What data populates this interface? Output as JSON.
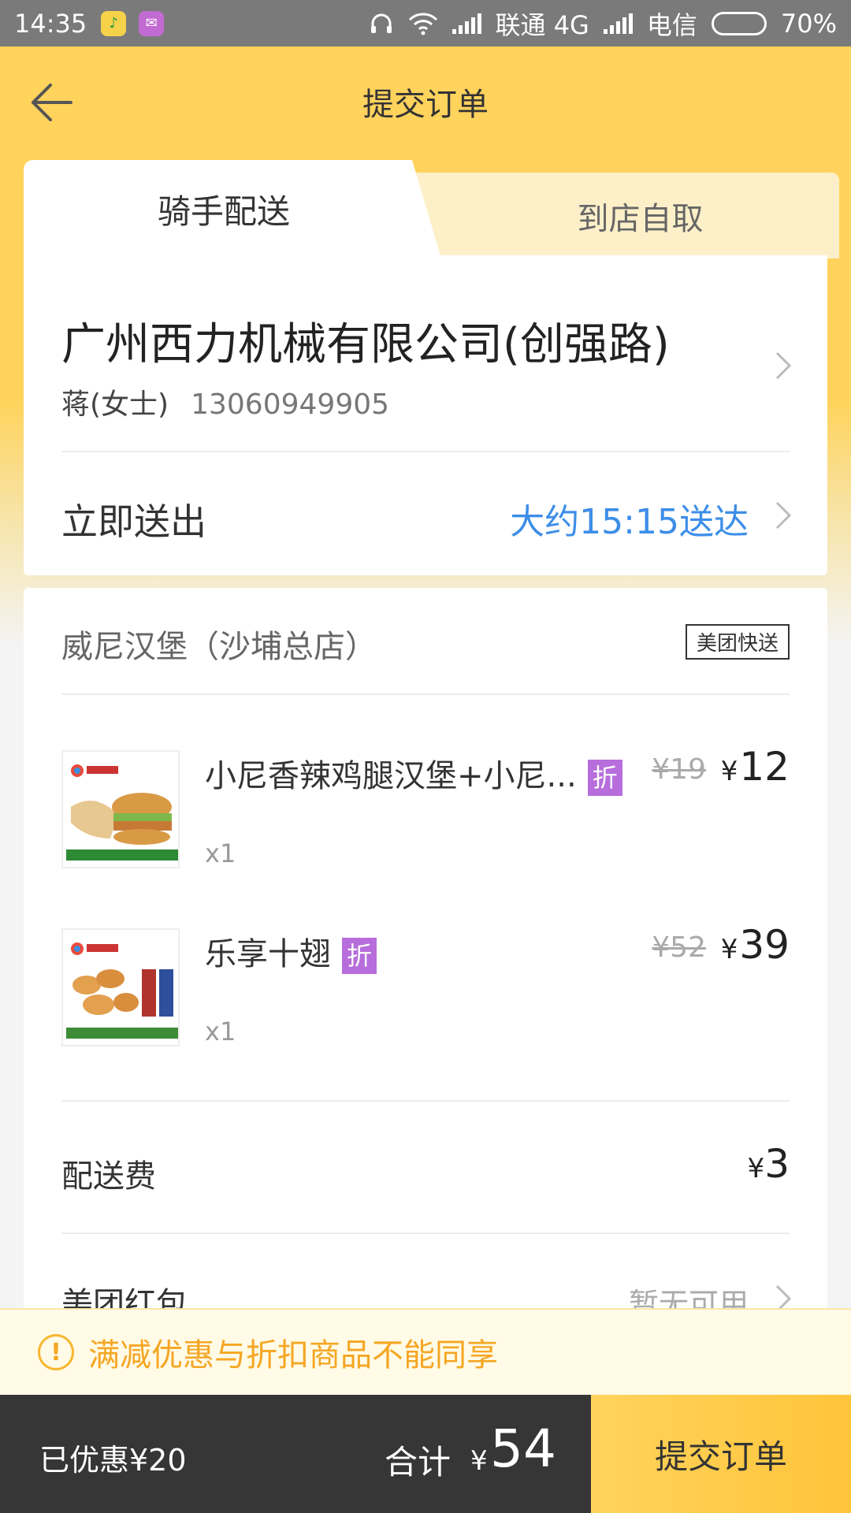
{
  "status_bar": {
    "time": "14:35",
    "carrier1": "联通 4G",
    "carrier2": "电信",
    "battery": "70%",
    "battery_level": 0.7
  },
  "header": {
    "title": "提交订单"
  },
  "tabs": {
    "active": "骑手配送",
    "inactive": "到店自取"
  },
  "address": {
    "title": "广州西力机械有限公司(创强路)",
    "name": "蒋(女士)",
    "phone": "13060949905"
  },
  "delivery": {
    "label": "立即送出",
    "eta": "大约15:15送达"
  },
  "shop": {
    "name": "威尼汉堡（沙埔总店）",
    "badge": "美团快送"
  },
  "items": [
    {
      "name": "小尼香辣鸡腿汉堡+小尼...",
      "tag": "折",
      "orig_price": "¥19",
      "price_symbol": "¥",
      "price": "12",
      "qty": "x1"
    },
    {
      "name": "乐享十翅",
      "tag": "折",
      "orig_price": "¥52",
      "price_symbol": "¥",
      "price": "39",
      "qty": "x1"
    }
  ],
  "fees": {
    "delivery_label": "配送费",
    "delivery_symbol": "¥",
    "delivery_value": "3",
    "redpack_label": "美团红包",
    "redpack_value": "暂无可用"
  },
  "notice": {
    "text": "满减优惠与折扣商品不能同享"
  },
  "bottom": {
    "saved": "已优惠¥20",
    "total_label": "合计",
    "total_symbol": "¥",
    "total_value": "54",
    "submit": "提交订单"
  },
  "colors": {
    "brand_yellow": "#ffd35c",
    "link_blue": "#3d8ee8",
    "discount_purple": "#b76ddb",
    "notice_orange": "#f5a623"
  }
}
